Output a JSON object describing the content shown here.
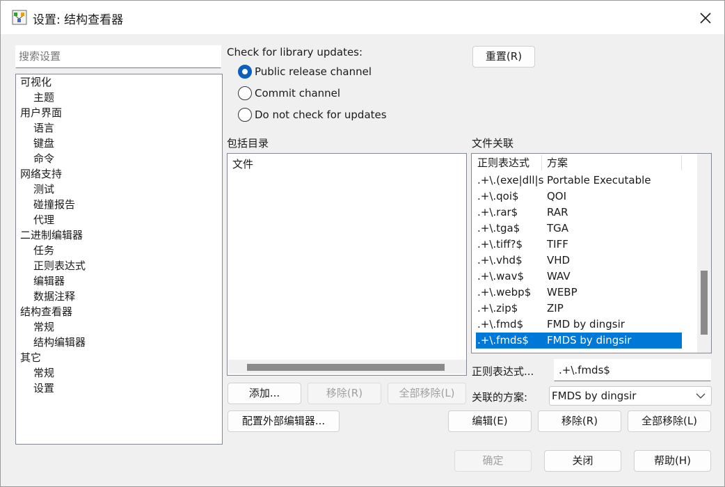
{
  "window": {
    "title": "设置: 结构查看器",
    "icon": "settings-app-icon",
    "close_icon": "close-icon"
  },
  "search": {
    "placeholder": "搜索设置"
  },
  "tree": [
    {
      "label": "可视化",
      "level": 0
    },
    {
      "label": "主题",
      "level": 1
    },
    {
      "label": "用户界面",
      "level": 0
    },
    {
      "label": "语言",
      "level": 1
    },
    {
      "label": "键盘",
      "level": 1
    },
    {
      "label": "命令",
      "level": 1
    },
    {
      "label": "网络支持",
      "level": 0
    },
    {
      "label": "测试",
      "level": 1
    },
    {
      "label": "碰撞报告",
      "level": 1
    },
    {
      "label": "代理",
      "level": 1
    },
    {
      "label": "二进制编辑器",
      "level": 0
    },
    {
      "label": "任务",
      "level": 1
    },
    {
      "label": "正则表达式",
      "level": 1
    },
    {
      "label": "编辑器",
      "level": 1
    },
    {
      "label": "数据注释",
      "level": 1
    },
    {
      "label": "结构查看器",
      "level": 0
    },
    {
      "label": "常规",
      "level": 1
    },
    {
      "label": "结构编辑器",
      "level": 1
    },
    {
      "label": "其它",
      "level": 0
    },
    {
      "label": "常规",
      "level": 1
    },
    {
      "label": "设置",
      "level": 1
    }
  ],
  "updates": {
    "label": "Check for library updates:",
    "options": [
      "Public release channel",
      "Commit channel",
      "Do not check for updates"
    ],
    "selected_index": 0,
    "reset_button": "重置(R)"
  },
  "include_dirs": {
    "label": "包括目录",
    "items": [
      "文件"
    ],
    "add_button": "添加...",
    "remove_button": "移除(R)",
    "remove_all_button": "全部移除(L)",
    "configure_button": "配置外部编辑器..."
  },
  "file_assoc": {
    "label": "文件关联",
    "columns": [
      "正则表达式",
      "方案"
    ],
    "rows": [
      [
        ".+\\.(exe|dll|sys)$",
        "Portable Executable"
      ],
      [
        ".+\\.qoi$",
        "QOI"
      ],
      [
        ".+\\.rar$",
        "RAR"
      ],
      [
        ".+\\.tga$",
        "TGA"
      ],
      [
        ".+\\.tiff?$",
        "TIFF"
      ],
      [
        ".+\\.vhd$",
        "VHD"
      ],
      [
        ".+\\.wav$",
        "WAV"
      ],
      [
        ".+\\.webp$",
        "WEBP"
      ],
      [
        ".+\\.zip$",
        "ZIP"
      ],
      [
        ".+\\.fmd$",
        "FMD by dingsir"
      ],
      [
        ".+\\.fmds$",
        "FMDS by dingsir"
      ]
    ],
    "selected_row": 10,
    "regex_label": "正则表达式...",
    "regex_value": ".+\\.fmds$",
    "scheme_label": "关联的方案:",
    "scheme_value": "FMDS by dingsir",
    "edit_button": "编辑(E)",
    "remove_button": "移除(R)",
    "remove_all_button": "全部移除(L)"
  },
  "footer": {
    "ok_button": "确定",
    "close_button": "关闭",
    "help_button": "帮助(H)"
  },
  "colors": {
    "selection": "#0078d7",
    "radio_accent": "#0a5fbf",
    "dialog_bg": "#f0f0f0"
  }
}
